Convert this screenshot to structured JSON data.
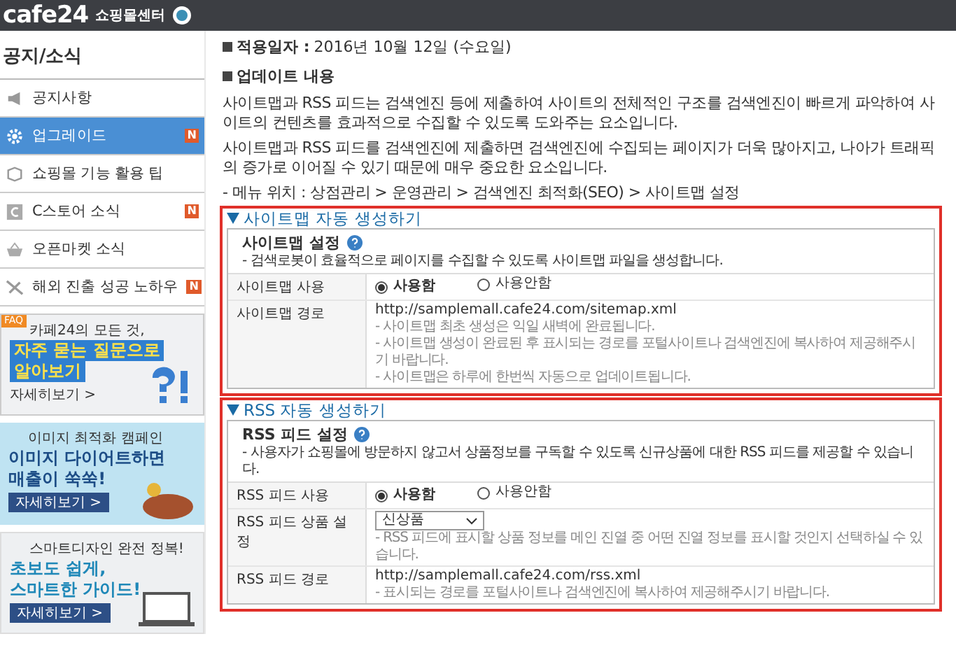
{
  "header": {
    "logo": "cafe24",
    "service": "쇼핑몰센터"
  },
  "sidebar": {
    "title": "공지/소식",
    "items": [
      {
        "label": "공지사항",
        "selected": false
      },
      {
        "label": "업그레이드",
        "selected": true,
        "badge": "N"
      },
      {
        "label": "쇼핑몰 기능 활용 팁",
        "selected": false
      },
      {
        "label": "C스토어 소식",
        "selected": false,
        "badge": "N"
      },
      {
        "label": "오픈마켓 소식",
        "selected": false
      },
      {
        "label": "해외 진출 성공 노하우",
        "selected": false,
        "badge": "N"
      }
    ],
    "banners": [
      {
        "kind": "faq",
        "ribbon": "FAQ",
        "kicker": "카페24의 모든 것,",
        "headline": [
          "자주 묻는 질문으로",
          "알아보기"
        ],
        "link": "자세히보기 >"
      },
      {
        "kind": "image",
        "kicker": "이미지 최적화 캠페인",
        "headline": [
          "이미지 다이어트하면",
          "매출이 쑥쑥!"
        ],
        "link": "자세히보기 >"
      },
      {
        "kind": "smart",
        "kicker": "스마트디자인 완전 정복!",
        "headline": [
          "초보도 쉽게,",
          "스마트한 가이드!"
        ],
        "link": "자세히보기 >"
      }
    ]
  },
  "main": {
    "date_label": "적용일자 :",
    "date": "2016년 10월 12일 (수요일)",
    "update_title": "업데이트 내용",
    "paragraphs": [
      "사이트맵과 RSS 피드는 검색엔진 등에 제출하여 사이트의 전체적인 구조를 검색엔진이 빠르게 파악하여 사이트의 컨텐츠를 효과적으로 수집할 수 있도록 도와주는 요소입니다.",
      "사이트맵과 RSS 피드를 검색엔진에 제출하면 검색엔진에 수집되는 페이지가 더욱 많아지고, 나아가 트래픽의 증가로 이어질 수 있기 때문에 매우 중요한 요소입니다."
    ],
    "menu_path": "- 메뉴 위치 : 상점관리 > 운영관리 > 검색엔진 최적화(SEO) > 사이트맵 설정",
    "sections": [
      {
        "title": "사이트맵 자동 생성하기",
        "highlighted": true,
        "box_title": "사이트맵 설정",
        "description": "- 검색로봇이 효율적으로 페이지를 수집할 수 있도록 사이트맵 파일을 생성합니다.",
        "rows": [
          {
            "kind": "radio",
            "label": "사이트맵 사용",
            "options": [
              {
                "label": "사용함",
                "selected": true
              },
              {
                "label": "사용안함",
                "selected": false
              }
            ]
          },
          {
            "kind": "path",
            "label": "사이트맵 경로",
            "value": "http://samplemall.cafe24.com/sitemap.xml",
            "notes": [
              "- 사이트맵 최초 생성은 익일 새벽에 완료됩니다.",
              "- 사이트맵 생성이 완료된 후 표시되는 경로를 포털사이트나 검색엔진에 복사하여 제공해주시기 바랍니다.",
              "- 사이트맵은 하루에 한번씩 자동으로 업데이트됩니다."
            ]
          }
        ]
      },
      {
        "title": "RSS 자동 생성하기",
        "highlighted": true,
        "box_title": "RSS 피드 설정",
        "description": "- 사용자가 쇼핑몰에 방문하지 않고서 상품정보를 구독할 수 있도록 신규상품에 대한 RSS 피드를 제공할 수 있습니다.",
        "rows": [
          {
            "kind": "radio",
            "label": "RSS 피드 사용",
            "options": [
              {
                "label": "사용함",
                "selected": true
              },
              {
                "label": "사용안함",
                "selected": false
              }
            ]
          },
          {
            "kind": "select",
            "label": "RSS 피드 상품 설정",
            "value": "신상품",
            "notes": [
              "- RSS 피드에 표시할 상품 정보를 메인 진열 중 어떤 진열 정보를 표시할 것인지 선택하실 수 있습니다."
            ]
          },
          {
            "kind": "path",
            "label": "RSS 피드 경로",
            "value": "http://samplemall.cafe24.com/rss.xml",
            "notes": [
              "- 표시되는 경로를 포털사이트나 검색엔진에 복사하여 제공해주시기 바랍니다."
            ]
          }
        ]
      }
    ]
  }
}
